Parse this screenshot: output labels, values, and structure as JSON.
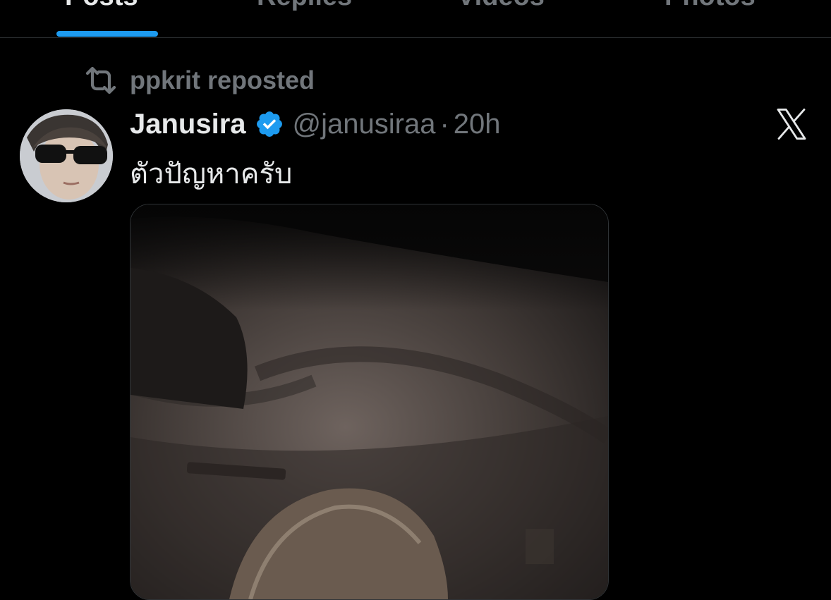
{
  "tabs": [
    {
      "label": "Posts",
      "active": true
    },
    {
      "label": "Replies",
      "active": false
    },
    {
      "label": "Videos",
      "active": false
    },
    {
      "label": "Photos",
      "active": false
    }
  ],
  "repost": {
    "icon": "repost-icon",
    "text": "ppkrit reposted"
  },
  "post": {
    "author": {
      "display_name": "Janusira",
      "verified": true,
      "handle": "@janusiraa"
    },
    "separator": "·",
    "time": "20h",
    "text": "ตัวปัญหาครับ",
    "brand_icon": "x-logo-icon"
  },
  "colors": {
    "background": "#000000",
    "accent": "#1d9bf0",
    "primary_text": "#e7e9ea",
    "secondary_text": "#71767b",
    "divider": "#2f3336"
  }
}
